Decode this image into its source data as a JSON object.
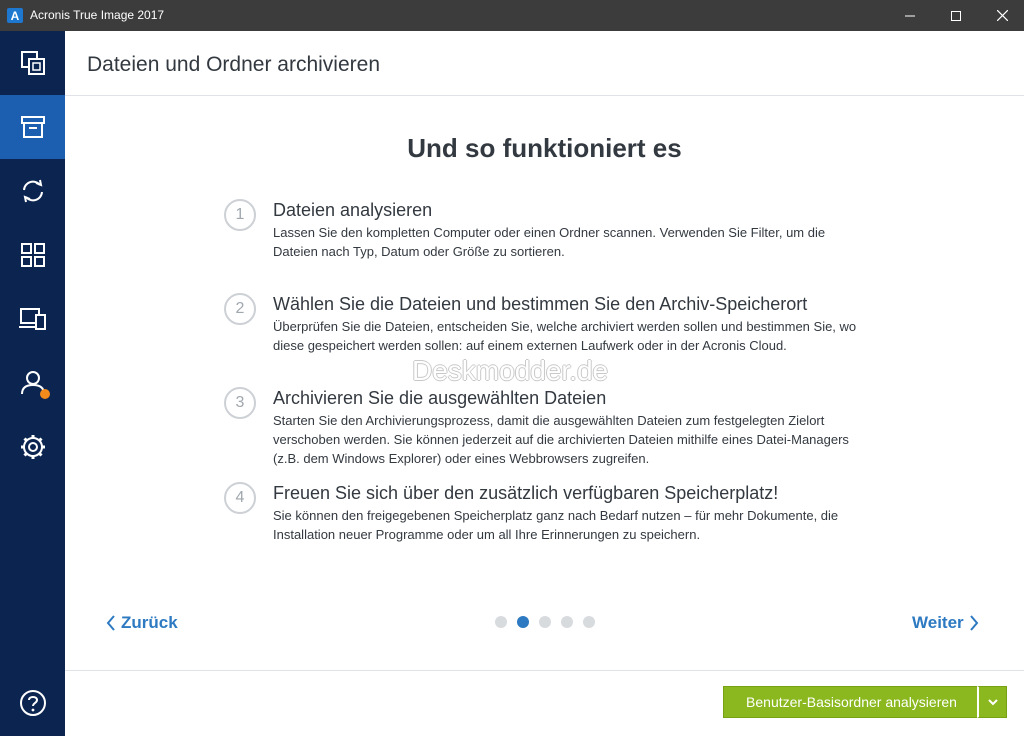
{
  "window": {
    "title": "Acronis True Image 2017",
    "logo_letter": "A"
  },
  "sidebar": {
    "items": [
      {
        "icon": "backup-icon",
        "active": false
      },
      {
        "icon": "archive-icon",
        "active": true
      },
      {
        "icon": "sync-icon",
        "active": false
      },
      {
        "icon": "tools-grid-icon",
        "active": false
      },
      {
        "icon": "devices-icon",
        "active": false
      },
      {
        "icon": "account-icon",
        "active": false,
        "notification": true
      },
      {
        "icon": "settings-gear-icon",
        "active": false
      },
      {
        "icon": "help-icon",
        "active": false
      }
    ]
  },
  "header": {
    "title": "Dateien und Ordner archivieren"
  },
  "content": {
    "heading": "Und so funktioniert es",
    "steps": [
      {
        "number": "1",
        "title": "Dateien analysieren",
        "description": "Lassen Sie den kompletten Computer oder einen Ordner scannen. Verwenden Sie Filter, um die Dateien nach Typ, Datum oder Größe zu sortieren."
      },
      {
        "number": "2",
        "title": "Wählen Sie die Dateien und bestimmen Sie den Archiv-Speicherort",
        "description": "Überprüfen Sie die Dateien, entscheiden Sie, welche archiviert werden sollen und bestimmen Sie, wo diese gespeichert werden sollen: auf einem externen Laufwerk oder in der Acronis Cloud."
      },
      {
        "number": "3",
        "title": "Archivieren Sie die ausgewählten Dateien",
        "description": "Starten Sie den Archivierungsprozess, damit die ausgewählten Dateien zum festgelegten Zielort verschoben werden. Sie können jederzeit auf die archivierten Dateien mithilfe eines Datei-Managers (z.B. dem Windows Explorer) oder eines Webbrowsers zugreifen."
      },
      {
        "number": "4",
        "title": "Freuen Sie sich über den zusätzlich verfügbaren Speicherplatz!",
        "description": "Sie können den freigegebenen Speicherplatz ganz nach Bedarf nutzen – für mehr Dokumente, die Installation neuer Programme oder um all Ihre Erinnerungen zu speichern."
      }
    ],
    "watermark": "Deskmodder.de"
  },
  "pager": {
    "back_label": "Zurück",
    "next_label": "Weiter",
    "total_pages": 5,
    "current_page": 2
  },
  "footer": {
    "primary_button": "Benutzer-Basisordner analysieren"
  },
  "colors": {
    "sidebar_bg": "#0c2550",
    "sidebar_active": "#1c5fb0",
    "accent_blue": "#2d7ac2",
    "primary_green": "#8ab81e",
    "notification_orange": "#f28a1c"
  }
}
